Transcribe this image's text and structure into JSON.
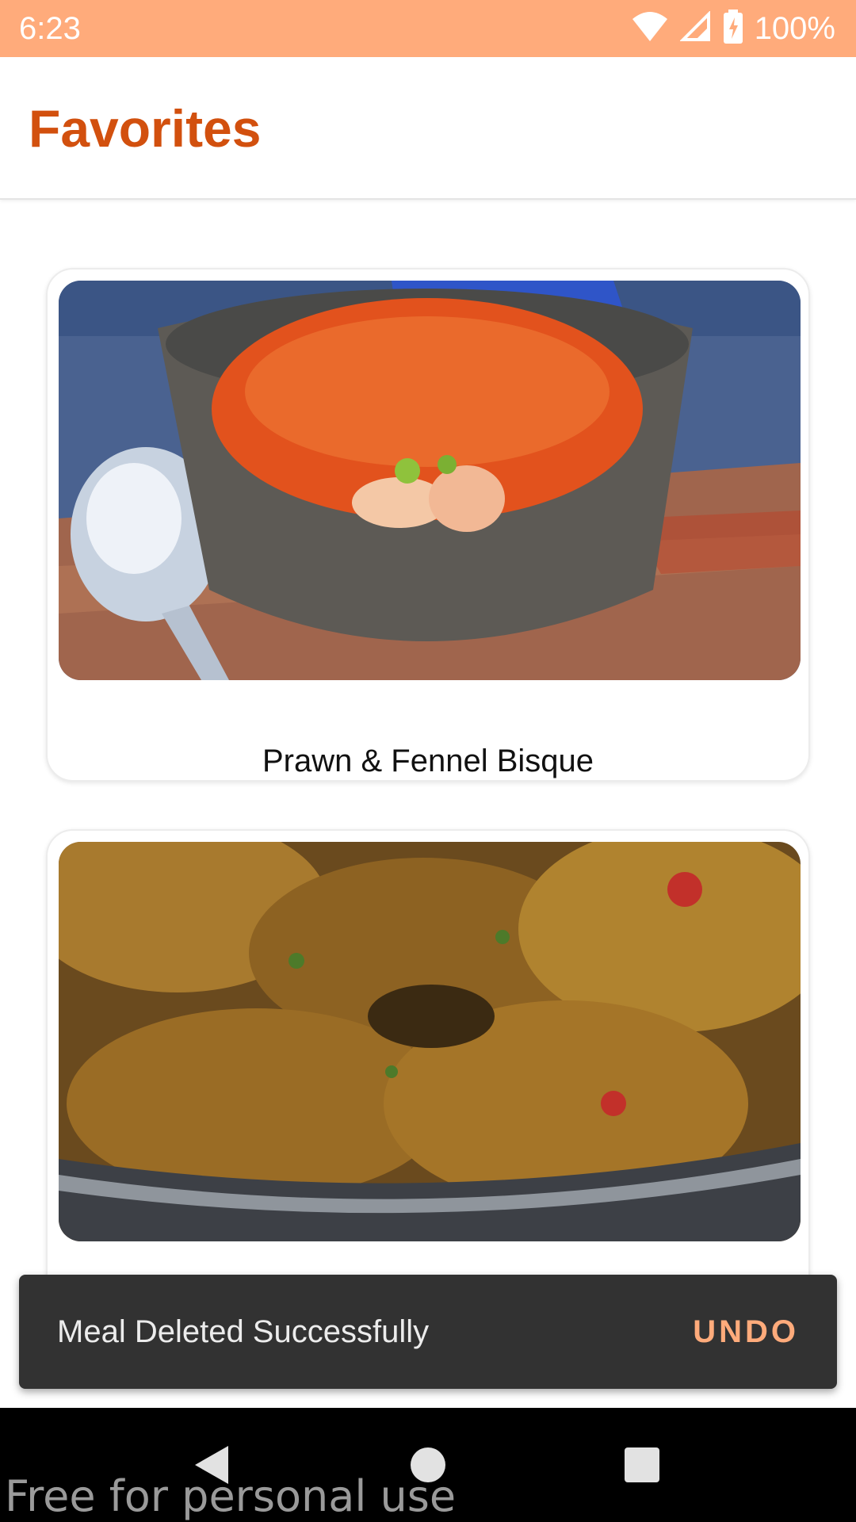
{
  "status_bar": {
    "time": "6:23",
    "battery": "100%",
    "icons": [
      "wifi-icon",
      "cell-signal-icon",
      "battery-charging-icon"
    ]
  },
  "app_bar": {
    "title": "Favorites"
  },
  "meals": [
    {
      "name": "Prawn & Fennel Bisque",
      "image": "prawn-bisque-photo"
    },
    {
      "name": "",
      "image": "chicken-curry-photo"
    }
  ],
  "snackbar": {
    "message": "Meal Deleted Successfully",
    "action": "UNDO"
  },
  "nav_bar": {
    "buttons": [
      "back-icon",
      "home-icon",
      "recents-icon"
    ]
  },
  "watermark": "Free for personal use",
  "colors": {
    "status_bar": "#ffab7b",
    "title": "#d2500e",
    "snackbar_bg": "#323232",
    "snackbar_action": "#ffab7b",
    "nav_bar": "#000000"
  }
}
